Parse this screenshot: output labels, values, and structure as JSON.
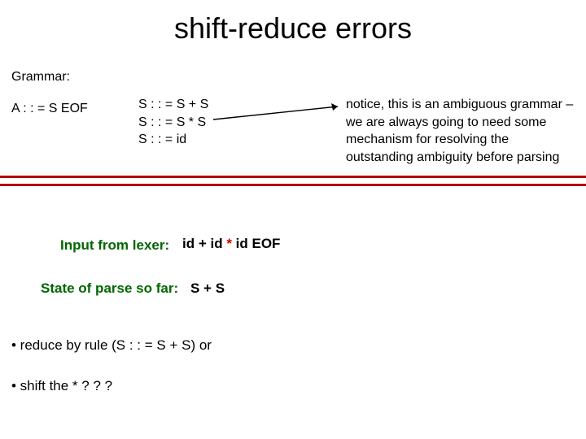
{
  "title": "shift-reduce errors",
  "grammar_label": "Grammar:",
  "rule_a": "A : : = S EOF",
  "rules_s": {
    "r1": "S : : = S + S",
    "r2": "S : : = S * S",
    "r3": "S : : = id"
  },
  "notice": "notice, this is an ambiguous grammar – we are always going to need some mechanism for resolving the outstanding ambiguity before parsing",
  "lexer_label": "Input from lexer:",
  "lexer_value_prefix": "id + id ",
  "lexer_value_star": "*",
  "lexer_value_suffix": " id EOF",
  "state_label": "State of parse so far:",
  "state_value": "S + S",
  "bullet1": "• reduce by rule (S : : = S + S) or",
  "bullet2": "• shift the * ? ? ?"
}
